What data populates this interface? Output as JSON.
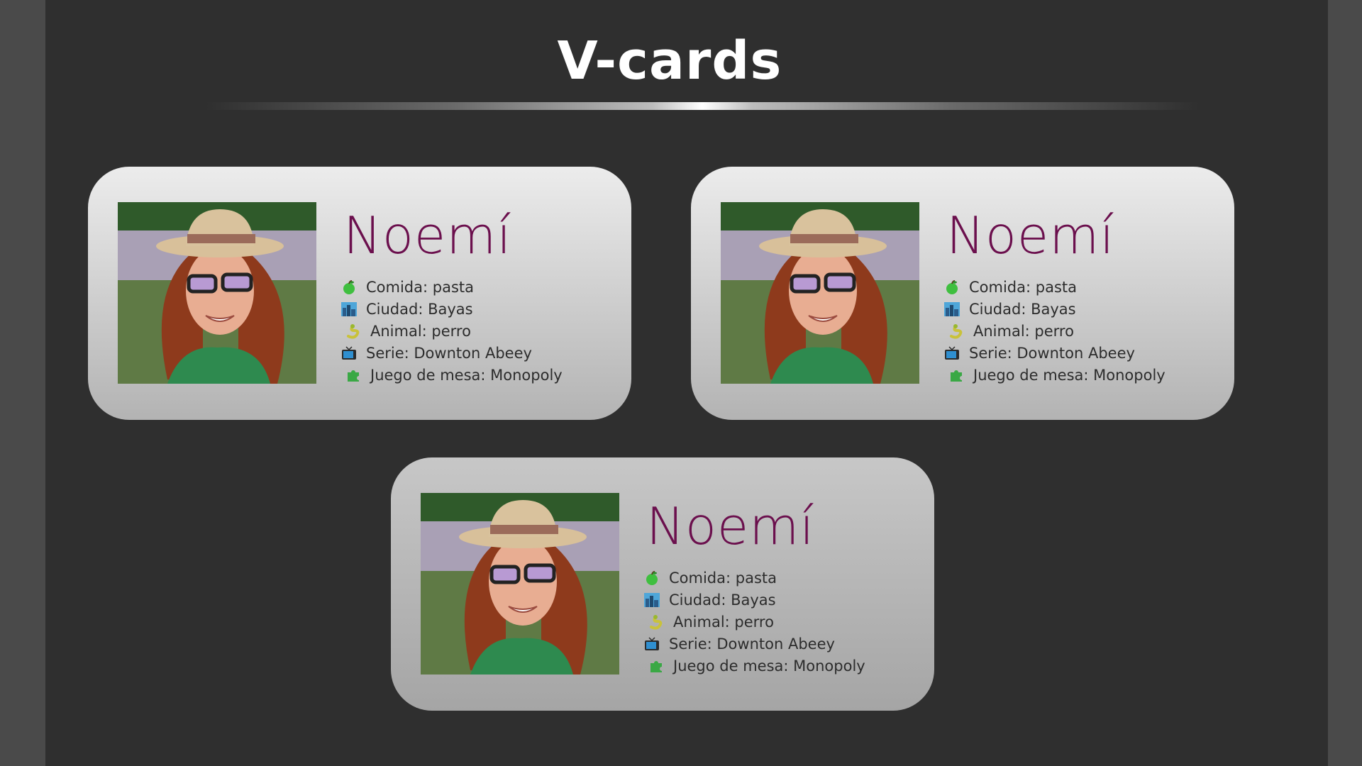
{
  "header": {
    "title": "V-cards"
  },
  "cards": [
    {
      "name": "Noemí",
      "facts": [
        {
          "icon": "green-apple-icon",
          "text": "Comida: pasta"
        },
        {
          "icon": "cityscape-icon",
          "text": "Ciudad: Bayas"
        },
        {
          "icon": "snake-icon",
          "text": "Animal: perro"
        },
        {
          "icon": "television-icon",
          "text": "Serie: Downton Abeey"
        },
        {
          "icon": "puzzle-piece-icon",
          "text": "Juego de mesa: Monopoly"
        }
      ]
    },
    {
      "name": "Noemí",
      "facts": [
        {
          "icon": "green-apple-icon",
          "text": "Comida: pasta"
        },
        {
          "icon": "cityscape-icon",
          "text": "Ciudad: Bayas"
        },
        {
          "icon": "snake-icon",
          "text": "Animal: perro"
        },
        {
          "icon": "television-icon",
          "text": "Serie: Downton Abeey"
        },
        {
          "icon": "puzzle-piece-icon",
          "text": "Juego de mesa: Monopoly"
        }
      ]
    },
    {
      "name": "Noemí",
      "facts": [
        {
          "icon": "green-apple-icon",
          "text": "Comida: pasta"
        },
        {
          "icon": "cityscape-icon",
          "text": "Ciudad: Bayas"
        },
        {
          "icon": "snake-icon",
          "text": "Animal: perro"
        },
        {
          "icon": "television-icon",
          "text": "Serie: Downton Abeey"
        },
        {
          "icon": "puzzle-piece-icon",
          "text": "Juego de mesa: Monopoly"
        }
      ]
    }
  ],
  "colors": {
    "page_background": "#2f2f2f",
    "side_margin": "#4a4a4a",
    "name_color": "#6b0f4d",
    "text_color": "#2c2c2c"
  }
}
